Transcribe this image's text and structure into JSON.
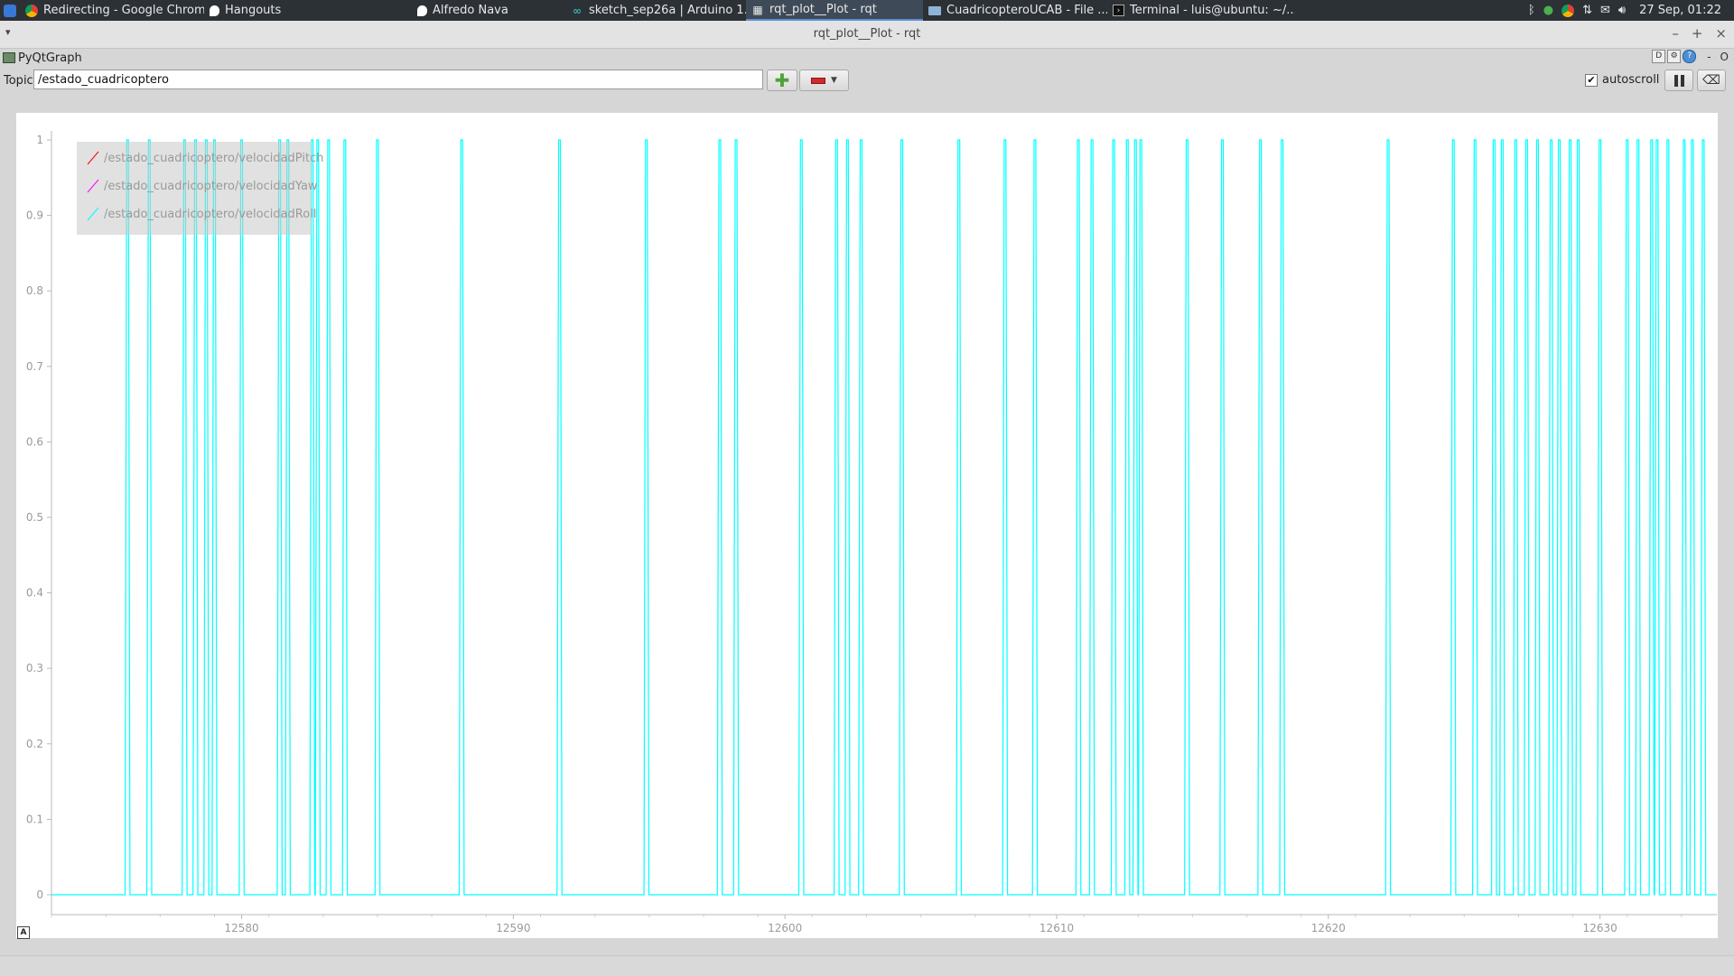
{
  "taskbar": {
    "tasks": [
      {
        "label": "Redirecting - Google Chrome",
        "icon": "chrome-icon"
      },
      {
        "label": "Hangouts",
        "icon": "hangouts-icon"
      },
      {
        "label": "Alfredo Nava",
        "icon": "hangouts-icon"
      },
      {
        "label": "sketch_sep26a | Arduino 1...",
        "icon": "arduino-icon"
      },
      {
        "label": "rqt_plot__Plot - rqt",
        "icon": "grid-icon",
        "active": true
      },
      {
        "label": "CuadricopteroUCAB - File ...",
        "icon": "folder-icon"
      },
      {
        "label": "Terminal - luis@ubuntu: ~/...",
        "icon": "terminal-icon"
      }
    ],
    "clock": "27 Sep, 01:22"
  },
  "window": {
    "title": "rqt_plot__Plot - rqt"
  },
  "plugin": {
    "title": "PyQtGraph",
    "buttons": [
      "D",
      "",
      "?",
      "-",
      "O"
    ]
  },
  "toolbar": {
    "topic_label": "Topic",
    "topic_value": "/estado_cuadricoptero",
    "autoscroll_label": "autoscroll",
    "autoscroll_checked": true
  },
  "plot": {
    "auto_range_label": "A"
  },
  "chart_data": {
    "type": "line",
    "xlim": [
      12573,
      12634.3
    ],
    "ylim": [
      0,
      1
    ],
    "x_ticks": [
      12580,
      12590,
      12600,
      12610,
      12620,
      12630
    ],
    "x_tick_labels": [
      "12580",
      "12590",
      "12600",
      "12610",
      "12620",
      "12630"
    ],
    "y_ticks": [
      0,
      0.1,
      0.2,
      0.3,
      0.4,
      0.5,
      0.6,
      0.7,
      0.8,
      0.9,
      1
    ],
    "y_tick_labels": [
      "0",
      "0.1",
      "0.2",
      "0.3",
      "0.4",
      "0.5",
      "0.6",
      "0.7",
      "0.8",
      "0.9",
      "1"
    ],
    "grid": false,
    "legend_position": "top-left",
    "series": [
      {
        "name": "/estado_cuadricoptero/velocidadPitch",
        "color": "#ff0000",
        "pulse_x": []
      },
      {
        "name": "/estado_cuadricoptero/velocidadYaw",
        "color": "#ff00ff",
        "pulse_x": []
      },
      {
        "name": "/estado_cuadricoptero/velocidadRoll",
        "color": "#00ffff",
        "baseline": 0,
        "peak": 1,
        "pulse_x": [
          12575.8,
          12576.6,
          12577.9,
          12578.3,
          12578.7,
          12579.0,
          12580.0,
          12581.4,
          12581.7,
          12582.6,
          12582.8,
          12583.2,
          12583.8,
          12585.0,
          12588.1,
          12591.7,
          12594.9,
          12597.6,
          12598.2,
          12600.6,
          12601.9,
          12602.3,
          12602.8,
          12604.3,
          12606.4,
          12608.1,
          12609.2,
          12610.8,
          12611.3,
          12612.1,
          12612.6,
          12612.9,
          12613.1,
          12614.8,
          12616.1,
          12617.5,
          12618.3,
          12622.2,
          12624.6,
          12625.4,
          12626.1,
          12626.4,
          12626.9,
          12627.3,
          12627.7,
          12628.2,
          12628.5,
          12628.9,
          12629.2,
          12630.0,
          12631.0,
          12631.4,
          12631.9,
          12632.1,
          12632.5,
          12633.1,
          12633.4,
          12633.8
        ]
      }
    ]
  }
}
